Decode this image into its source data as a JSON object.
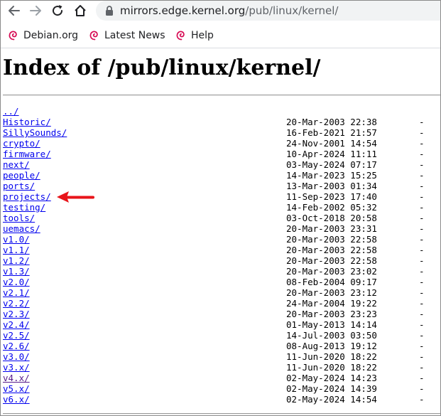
{
  "browser": {
    "url_host": "mirrors.edge.kernel.org",
    "url_path": "/pub/linux/kernel/"
  },
  "bookmarks": [
    {
      "label": "Debian.org",
      "icon": "debian-swirl-icon"
    },
    {
      "label": "Latest News",
      "icon": "debian-swirl-icon"
    },
    {
      "label": "Help",
      "icon": "debian-swirl-icon"
    }
  ],
  "page": {
    "title": "Index of /pub/linux/kernel/",
    "parent_link": "../",
    "entries": [
      {
        "name": "Historic/",
        "date": "20-Mar-2003 22:38",
        "size": "-"
      },
      {
        "name": "SillySounds/",
        "date": "16-Feb-2021 21:57",
        "size": "-"
      },
      {
        "name": "crypto/",
        "date": "24-Nov-2001 14:54",
        "size": "-"
      },
      {
        "name": "firmware/",
        "date": "10-Apr-2024 11:11",
        "size": "-"
      },
      {
        "name": "next/",
        "date": "03-May-2024 07:17",
        "size": "-"
      },
      {
        "name": "people/",
        "date": "14-Mar-2023 15:25",
        "size": "-"
      },
      {
        "name": "ports/",
        "date": "13-Mar-2003 01:34",
        "size": "-"
      },
      {
        "name": "projects/",
        "date": "11-Sep-2023 17:40",
        "size": "-"
      },
      {
        "name": "testing/",
        "date": "14-Feb-2002 05:32",
        "size": "-"
      },
      {
        "name": "tools/",
        "date": "03-Oct-2018 20:58",
        "size": "-"
      },
      {
        "name": "uemacs/",
        "date": "20-Mar-2003 23:31",
        "size": "-"
      },
      {
        "name": "v1.0/",
        "date": "20-Mar-2003 22:58",
        "size": "-"
      },
      {
        "name": "v1.1/",
        "date": "20-Mar-2003 22:58",
        "size": "-"
      },
      {
        "name": "v1.2/",
        "date": "20-Mar-2003 22:58",
        "size": "-"
      },
      {
        "name": "v1.3/",
        "date": "20-Mar-2003 23:02",
        "size": "-"
      },
      {
        "name": "v2.0/",
        "date": "08-Feb-2004 09:17",
        "size": "-"
      },
      {
        "name": "v2.1/",
        "date": "20-Mar-2003 23:12",
        "size": "-"
      },
      {
        "name": "v2.2/",
        "date": "24-Mar-2004 19:22",
        "size": "-"
      },
      {
        "name": "v2.3/",
        "date": "20-Mar-2003 23:23",
        "size": "-"
      },
      {
        "name": "v2.4/",
        "date": "01-May-2013 14:14",
        "size": "-"
      },
      {
        "name": "v2.5/",
        "date": "14-Jul-2003 03:50",
        "size": "-"
      },
      {
        "name": "v2.6/",
        "date": "08-Aug-2013 19:12",
        "size": "-"
      },
      {
        "name": "v3.0/",
        "date": "11-Jun-2020 18:22",
        "size": "-"
      },
      {
        "name": "v3.x/",
        "date": "11-Jun-2020 18:22",
        "size": "-"
      },
      {
        "name": "v4.x/",
        "date": "02-May-2024 14:23",
        "size": "-",
        "visited": true
      },
      {
        "name": "v5.x/",
        "date": "02-May-2024 14:39",
        "size": "-"
      },
      {
        "name": "v6.x/",
        "date": "02-May-2024 14:54",
        "size": "-"
      }
    ]
  },
  "annotation": {
    "arrow_color": "#e8141a",
    "arrow_icon": "red-arrow-left-icon"
  },
  "colors": {
    "link": "#0000ee",
    "visited_link": "#551a8b",
    "urlbar_bg": "#f1f3f4",
    "debian_red": "#d70a53"
  }
}
